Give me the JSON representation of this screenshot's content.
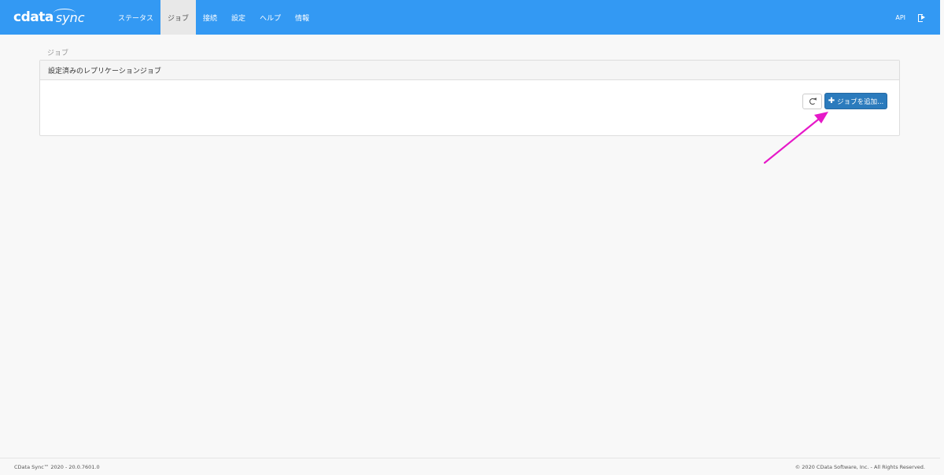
{
  "navbar": {
    "brand_cdata": "cdata",
    "brand_sync": "sync",
    "items": [
      {
        "label": "ステータス"
      },
      {
        "label": "ジョブ"
      },
      {
        "label": "接続"
      },
      {
        "label": "設定"
      },
      {
        "label": "ヘルプ"
      },
      {
        "label": "情報"
      }
    ],
    "active_index": 1,
    "api_label": "API",
    "logout_icon": "sign-out-icon"
  },
  "breadcrumb": "ジョブ",
  "panel": {
    "heading": "設定済みのレプリケーションジョブ",
    "refresh_icon": "refresh-icon",
    "add_button_label": "ジョブを追加...",
    "add_button_icon": "plus-icon"
  },
  "annotation": {
    "color": "#e619c8"
  },
  "footer": {
    "version": "CData Sync™ 2020 - 20.0.7601.0",
    "copyright": "© 2020 CData Software, Inc. - All Rights Reserved."
  },
  "colors": {
    "navbar_bg": "#3399f3",
    "primary_button": "#2b7bbd",
    "page_bg": "#f8f8f8"
  }
}
